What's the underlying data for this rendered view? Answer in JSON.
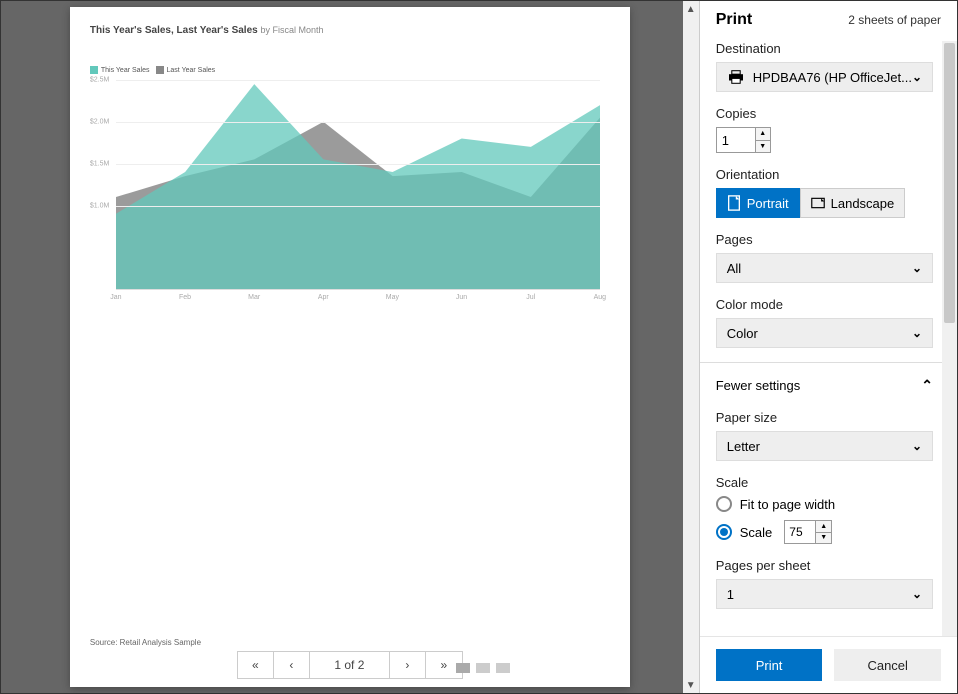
{
  "preview": {
    "chart_title": "This Year's Sales, Last Year's Sales",
    "chart_subtitle": "by Fiscal Month",
    "legend": {
      "series1": "This Year Sales",
      "series2": "Last Year Sales"
    },
    "source": "Source: Retail Analysis Sample",
    "pager": {
      "first": "«",
      "prev": "‹",
      "label": "1 of 2",
      "next": "›",
      "last": "»"
    }
  },
  "chart_data": {
    "type": "area",
    "categories": [
      "Jan",
      "Feb",
      "Mar",
      "Apr",
      "May",
      "Jun",
      "Jul",
      "Aug"
    ],
    "series": [
      {
        "name": "This Year Sales",
        "color": "#62c8bb",
        "values": [
          900000,
          1400000,
          2450000,
          1550000,
          1400000,
          1800000,
          1700000,
          2200000
        ]
      },
      {
        "name": "Last Year Sales",
        "color": "#8a8a8a",
        "values": [
          1100000,
          1350000,
          1550000,
          2000000,
          1350000,
          1400000,
          1100000,
          2050000
        ]
      }
    ],
    "ylabel": "",
    "ylim": [
      0,
      2500000
    ],
    "yticks": [
      1000000,
      1500000,
      2000000,
      2500000
    ],
    "ytick_labels": [
      "$1.0M",
      "$1.5M",
      "$2.0M",
      "$2.5M"
    ]
  },
  "print": {
    "title": "Print",
    "sheets": "2 sheets of paper",
    "destination_label": "Destination",
    "destination_value": "HPDBAA76 (HP OfficeJet...",
    "copies_label": "Copies",
    "copies_value": "1",
    "orientation_label": "Orientation",
    "portrait": "Portrait",
    "landscape": "Landscape",
    "pages_label": "Pages",
    "pages_value": "All",
    "color_label": "Color mode",
    "color_value": "Color",
    "fewer_settings": "Fewer settings",
    "paper_label": "Paper size",
    "paper_value": "Letter",
    "scale_label": "Scale",
    "fit_width": "Fit to page width",
    "scale_option": "Scale",
    "scale_value": "75",
    "pps_label": "Pages per sheet",
    "pps_value": "1",
    "print_btn": "Print",
    "cancel_btn": "Cancel"
  }
}
